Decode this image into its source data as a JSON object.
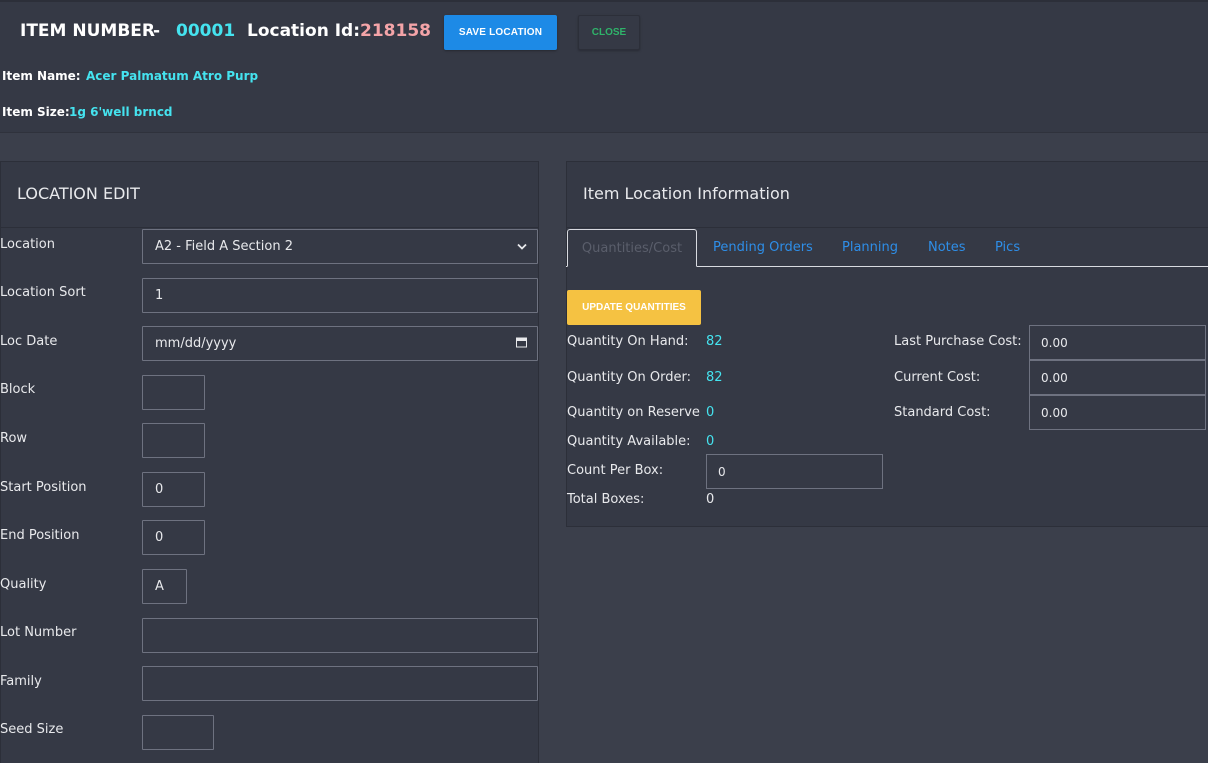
{
  "header": {
    "item_number_label": "ITEM NUMBER",
    "dash": "-",
    "item_number": "00001",
    "location_id_label": "Location Id:",
    "location_id": "218158",
    "save_label": "SAVE LOCATION",
    "close_label": "CLOSE",
    "item_name_label": "Item Name:",
    "item_name": "Acer Palmatum Atro Purp",
    "item_size_label": "Item Size:",
    "item_size": "1g 6'well brncd"
  },
  "location_edit": {
    "title": "LOCATION EDIT",
    "location_label": "Location",
    "location_value": "A2 - Field A Section 2",
    "location_sort_label": "Location Sort",
    "location_sort_value": "1",
    "loc_date_label": "Loc Date",
    "loc_date_placeholder": "mm/dd/yyyy",
    "block_label": "Block",
    "row_label": "Row",
    "start_position_label": "Start Position",
    "start_position_value": "0",
    "end_position_label": "End Position",
    "end_position_value": "0",
    "quality_label": "Quality",
    "quality_value": "A",
    "lot_number_label": "Lot Number",
    "family_label": "Family",
    "seed_size_label": "Seed Size"
  },
  "item_location_info": {
    "title": "Item Location Information",
    "tabs": [
      "Quantities/Cost",
      "Pending Orders",
      "Planning",
      "Notes",
      "Pics"
    ],
    "update_label": "UPDATE QUANTITIES",
    "qty_on_hand_label": "Quantity On Hand:",
    "qty_on_hand": "82",
    "qty_on_order_label": "Quantity On Order:",
    "qty_on_order": "82",
    "qty_on_reserve_label": "Quantity on Reserve",
    "qty_on_reserve": "0",
    "qty_available_label": "Quantity Available:",
    "qty_available": "0",
    "count_per_box_label": "Count Per Box:",
    "count_per_box": "0",
    "total_boxes_label": "Total Boxes:",
    "total_boxes": "0",
    "last_purchase_cost_label": "Last Purchase Cost:",
    "last_purchase_cost": "0.00",
    "current_cost_label": "Current Cost:",
    "current_cost": "0.00",
    "standard_cost_label": "Standard Cost:",
    "standard_cost": "0.00"
  },
  "colors": {
    "accent_cyan": "#45e3ef",
    "location_id_pink": "#f4a4a8",
    "save_blue": "#1d8ae6",
    "close_green": "#2fb36a",
    "update_yellow": "#f5c242",
    "tab_link_blue": "#2e8ee8"
  },
  "icons": {
    "select_arrow": "chevron-down-icon",
    "date_picker": "calendar-icon"
  }
}
